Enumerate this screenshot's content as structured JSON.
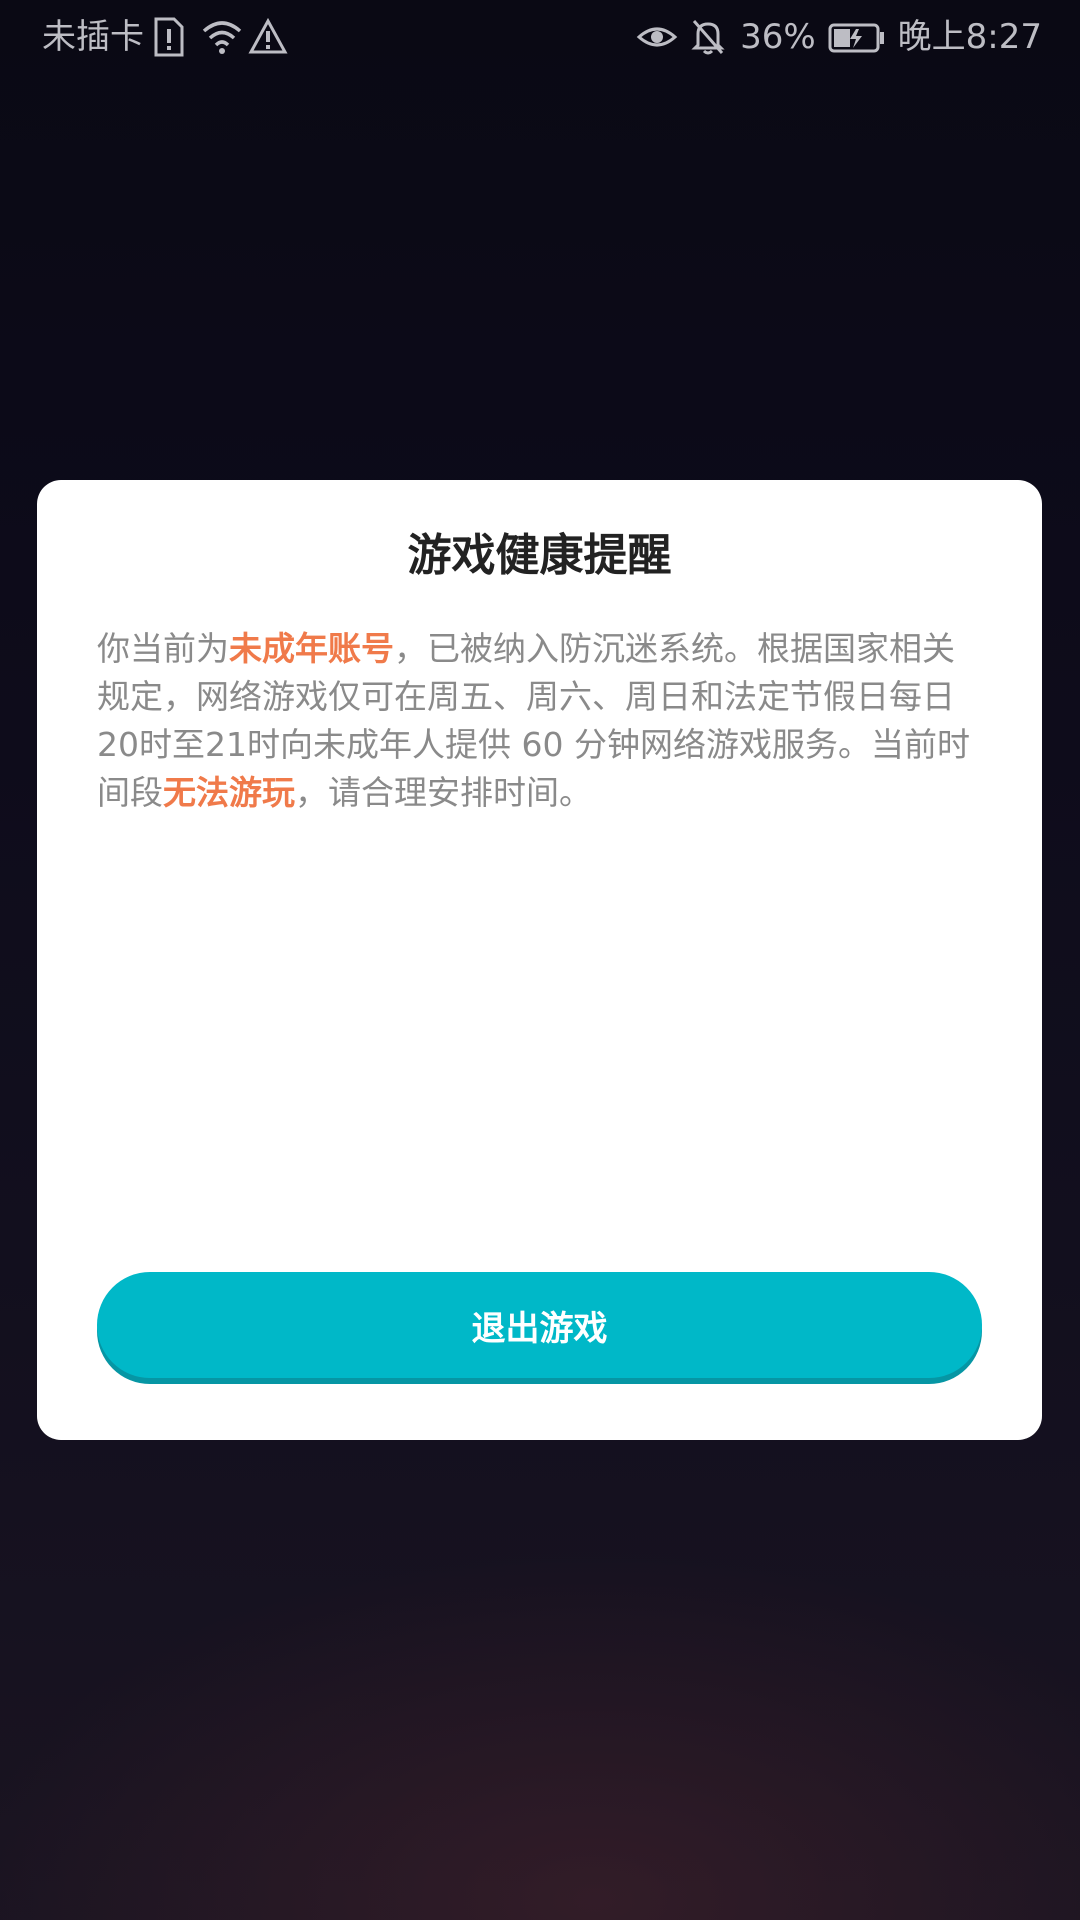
{
  "status_bar": {
    "carrier": "未插卡",
    "battery": "36%",
    "time": "晚上8:27",
    "icons": [
      "sim-alert-icon",
      "wifi-icon",
      "warning-icon",
      "eye-icon",
      "bell-off-icon",
      "battery-icon"
    ]
  },
  "dialog": {
    "title": "游戏健康提醒",
    "body": {
      "p1": "你当前为",
      "highlight1": "未成年账号",
      "p2": "，已被纳入防沉迷系统。根据国家相关规定，网络游戏仅可在周五、周六、周日和法定节假日每日20时至21时向未成年人提供 60 分钟网络游戏服务。当前时间段",
      "highlight2": "无法游玩",
      "p3": "，请合理安排时间。"
    },
    "exit_button": "退出游戏"
  },
  "colors": {
    "highlight": "#f07a4a",
    "button": "#00b8c8",
    "background": "#0d0b1a"
  }
}
